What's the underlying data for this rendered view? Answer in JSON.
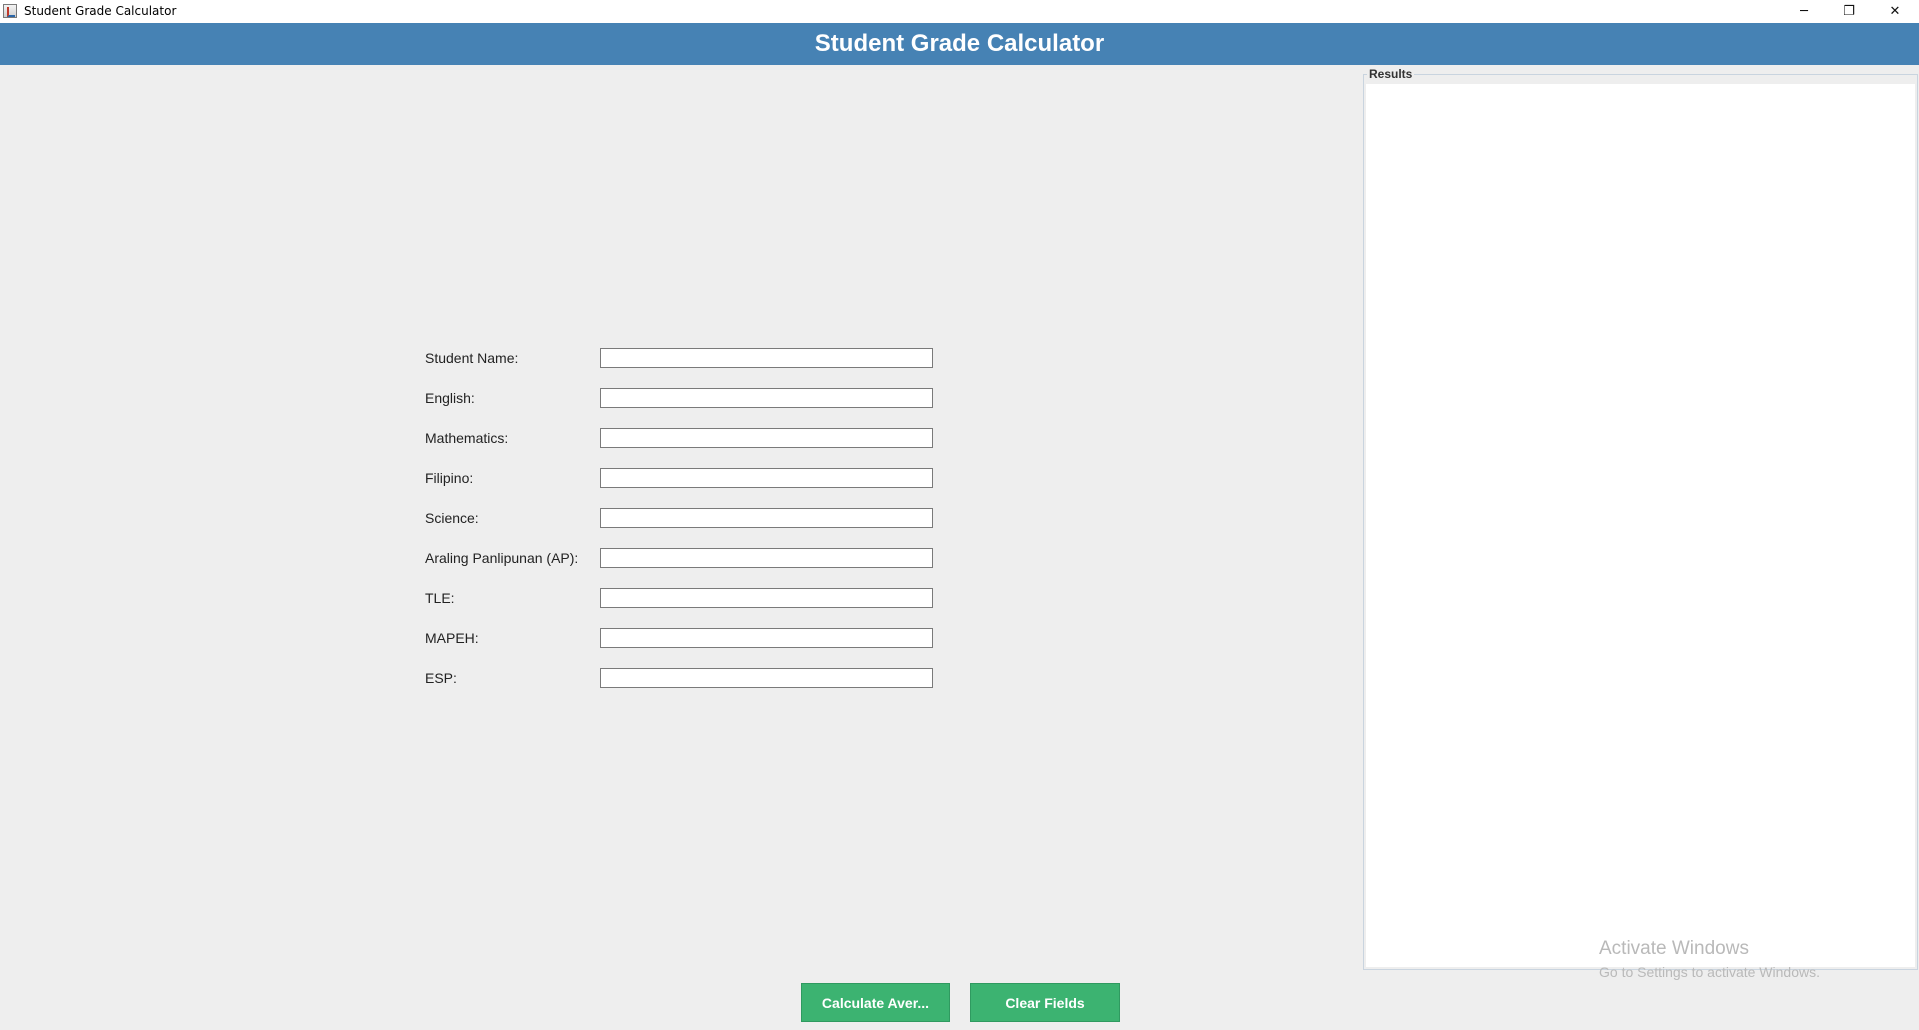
{
  "window": {
    "title": "Student Grade Calculator",
    "controls": {
      "minimize": "─",
      "maximize": "❐",
      "close": "✕"
    }
  },
  "header": {
    "title": "Student Grade Calculator",
    "background": "#4682b4"
  },
  "form": {
    "fields": [
      {
        "label": "Student Name:",
        "value": ""
      },
      {
        "label": "English:",
        "value": ""
      },
      {
        "label": "Mathematics:",
        "value": ""
      },
      {
        "label": "Filipino:",
        "value": ""
      },
      {
        "label": "Science:",
        "value": ""
      },
      {
        "label": "Araling Panlipunan (AP):",
        "value": ""
      },
      {
        "label": "TLE:",
        "value": ""
      },
      {
        "label": "MAPEH:",
        "value": ""
      },
      {
        "label": "ESP:",
        "value": ""
      }
    ]
  },
  "results": {
    "title": "Results",
    "content": ""
  },
  "buttons": {
    "calculate": "Calculate Aver...",
    "clear": "Clear Fields",
    "color": "#3cb371"
  },
  "watermark": {
    "title": "Activate Windows",
    "subtitle": "Go to Settings to activate Windows."
  }
}
